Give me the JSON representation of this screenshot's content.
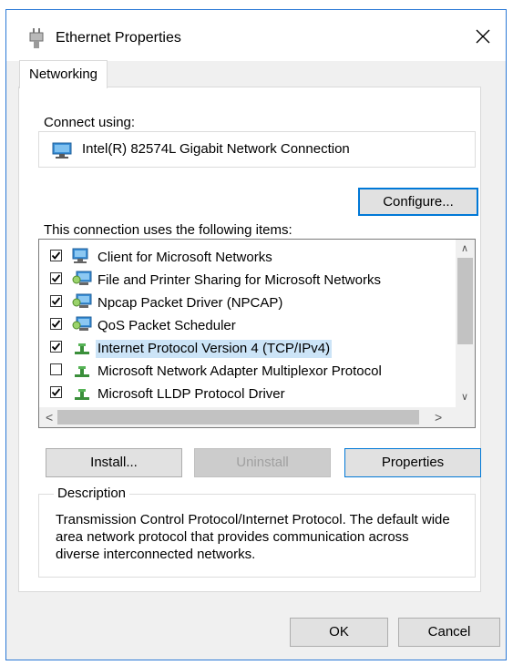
{
  "window": {
    "title": "Ethernet Properties",
    "close_glyph": "✕",
    "accent_color": "#0078d7"
  },
  "tabs": [
    {
      "label": "Networking",
      "active": true
    }
  ],
  "connect_using": {
    "label": "Connect using:",
    "adapter": "Intel(R) 82574L Gigabit Network Connection",
    "icon": "network-adapter-icon"
  },
  "buttons": {
    "configure": "Configure...",
    "install": "Install...",
    "uninstall": "Uninstall",
    "properties": "Properties",
    "ok": "OK",
    "cancel": "Cancel"
  },
  "items_label": "This connection uses the following items:",
  "items": [
    {
      "label": "Client for Microsoft Networks",
      "checked": true,
      "icon": "client-network-icon",
      "selected": false
    },
    {
      "label": "File and Printer Sharing for Microsoft Networks",
      "checked": true,
      "icon": "service-network-icon",
      "selected": false
    },
    {
      "label": "Npcap Packet Driver (NPCAP)",
      "checked": true,
      "icon": "service-network-icon",
      "selected": false
    },
    {
      "label": "QoS Packet Scheduler",
      "checked": true,
      "icon": "service-network-icon",
      "selected": false
    },
    {
      "label": "Internet Protocol Version 4 (TCP/IPv4)",
      "checked": true,
      "icon": "protocol-icon",
      "selected": true
    },
    {
      "label": "Microsoft Network Adapter Multiplexor Protocol",
      "checked": false,
      "icon": "protocol-icon",
      "selected": false
    },
    {
      "label": "Microsoft LLDP Protocol Driver",
      "checked": true,
      "icon": "protocol-icon",
      "selected": false
    }
  ],
  "description": {
    "legend": "Description",
    "text": "Transmission Control Protocol/Internet Protocol. The default wide area network protocol that provides communication across diverse interconnected networks."
  },
  "scroll_glyphs": {
    "up": "∧",
    "down": "∨",
    "left": "<",
    "right": ">"
  }
}
